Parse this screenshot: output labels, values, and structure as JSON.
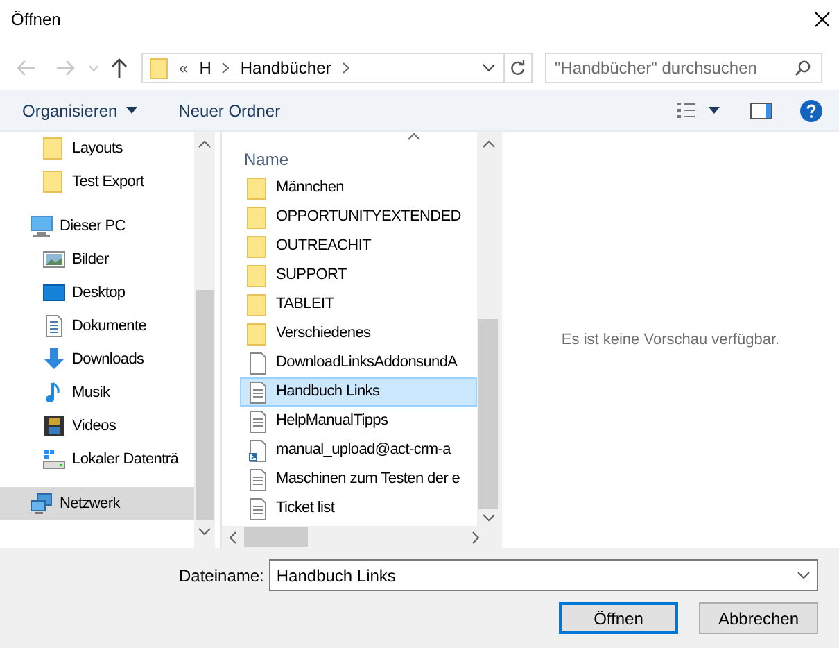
{
  "window": {
    "title": "Öffnen"
  },
  "address": {
    "overflow": "«",
    "crumbs": [
      "H",
      "Handbücher"
    ]
  },
  "search": {
    "placeholder": "\"Handbücher\" durchsuchen"
  },
  "toolbar": {
    "organize": "Organisieren",
    "new_folder": "Neuer Ordner"
  },
  "sidebar": {
    "items": [
      {
        "label": "Layouts",
        "kind": "folder",
        "selected": false
      },
      {
        "label": "Test Export",
        "kind": "folder",
        "selected": false
      },
      {
        "label": "Dieser PC",
        "kind": "pc",
        "selected": false
      },
      {
        "label": "Bilder",
        "kind": "pictures",
        "selected": false
      },
      {
        "label": "Desktop",
        "kind": "desktop",
        "selected": false
      },
      {
        "label": "Dokumente",
        "kind": "documents",
        "selected": false
      },
      {
        "label": "Downloads",
        "kind": "downloads",
        "selected": false
      },
      {
        "label": "Musik",
        "kind": "music",
        "selected": false
      },
      {
        "label": "Videos",
        "kind": "videos",
        "selected": false
      },
      {
        "label": "Lokaler Datenträ",
        "kind": "drive",
        "selected": false
      },
      {
        "label": "Netzwerk",
        "kind": "network",
        "selected": true
      }
    ]
  },
  "files": {
    "column": "Name",
    "rows": [
      {
        "name": "Männchen",
        "kind": "folder",
        "selected": false
      },
      {
        "name": "OPPORTUNITYEXTENDED",
        "kind": "folder",
        "selected": false
      },
      {
        "name": "OUTREACHIT",
        "kind": "folder",
        "selected": false
      },
      {
        "name": "SUPPORT",
        "kind": "folder",
        "selected": false
      },
      {
        "name": "TABLEIT",
        "kind": "folder",
        "selected": false
      },
      {
        "name": "Verschiedenes",
        "kind": "folder",
        "selected": false
      },
      {
        "name": "DownloadLinksAddonsundA",
        "kind": "blank",
        "selected": false
      },
      {
        "name": "Handbuch Links",
        "kind": "text",
        "selected": true
      },
      {
        "name": "HelpManualTipps",
        "kind": "text",
        "selected": false
      },
      {
        "name": "manual_upload@act-crm-a",
        "kind": "shortcut",
        "selected": false
      },
      {
        "name": "Maschinen zum Testen der e",
        "kind": "text",
        "selected": false
      },
      {
        "name": "Ticket list",
        "kind": "text",
        "selected": false
      }
    ]
  },
  "preview": {
    "message": "Es ist keine Vorschau verfügbar."
  },
  "filename": {
    "label": "Dateiname:",
    "value": "Handbuch Links"
  },
  "buttons": [
    {
      "label": "Öffnen",
      "default": true
    },
    {
      "label": "Abbrechen",
      "default": false
    }
  ]
}
